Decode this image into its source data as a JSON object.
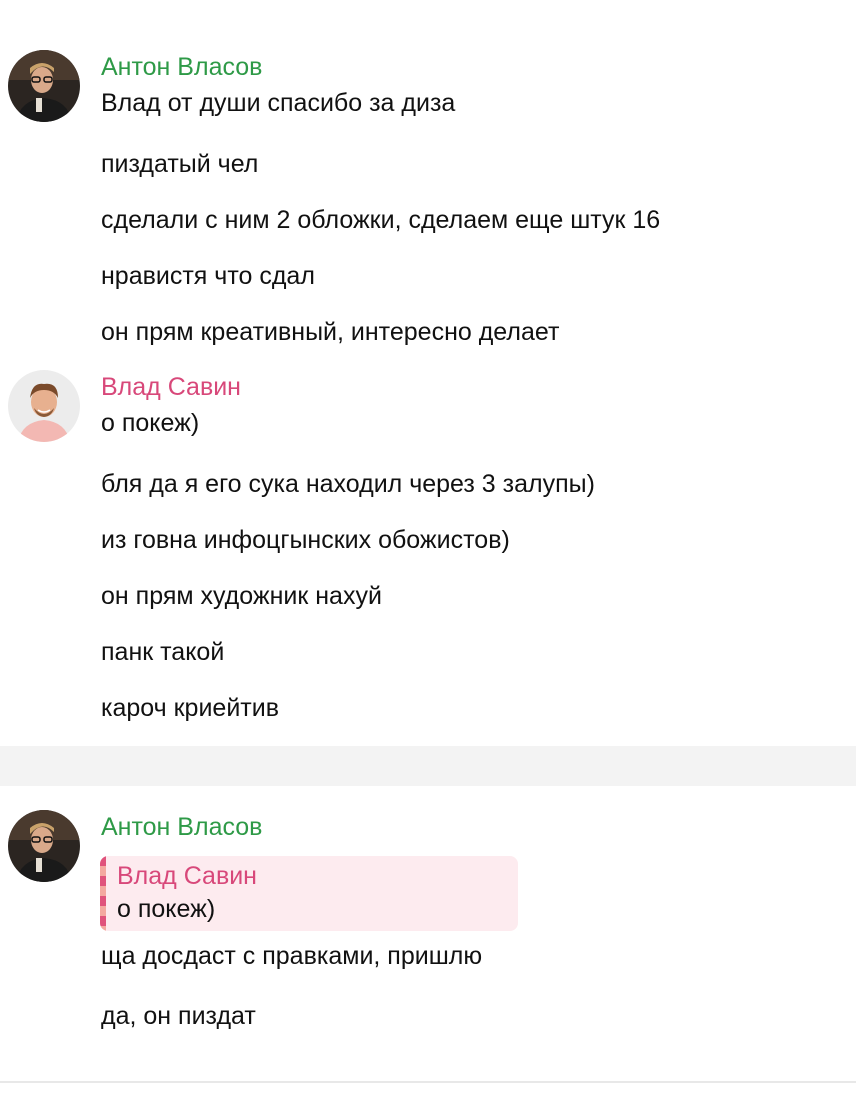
{
  "colors": {
    "anton_name": "#2e9a47",
    "vlad_name": "#d8487a",
    "reply_bg": "#fdebef"
  },
  "groups": [
    {
      "sender": "Антон Власов",
      "avatar": "anton-avatar",
      "messages": [
        "Влад от души спасибо за диза",
        "пиздатый чел",
        "сделали с ним 2 обложки, сделаем еще штук 16",
        "нравистя что сдал",
        "он прям креативный, интересно делает"
      ]
    },
    {
      "sender": "Влад Савин",
      "avatar": "vlad-avatar",
      "messages": [
        "о покеж)",
        "бля да я его сука находил через 3 залупы)",
        "из говна инфоцгынских обожистов)",
        "он прям художник нахуй",
        "панк такой",
        "кароч криейтив"
      ]
    },
    {
      "sender": "Антон Власов",
      "avatar": "anton-avatar",
      "reply": {
        "sender": "Влад Савин",
        "text": "о покеж)"
      },
      "messages": [
        "ща досдаст с правками, пришлю",
        "да, он пиздат"
      ]
    }
  ]
}
